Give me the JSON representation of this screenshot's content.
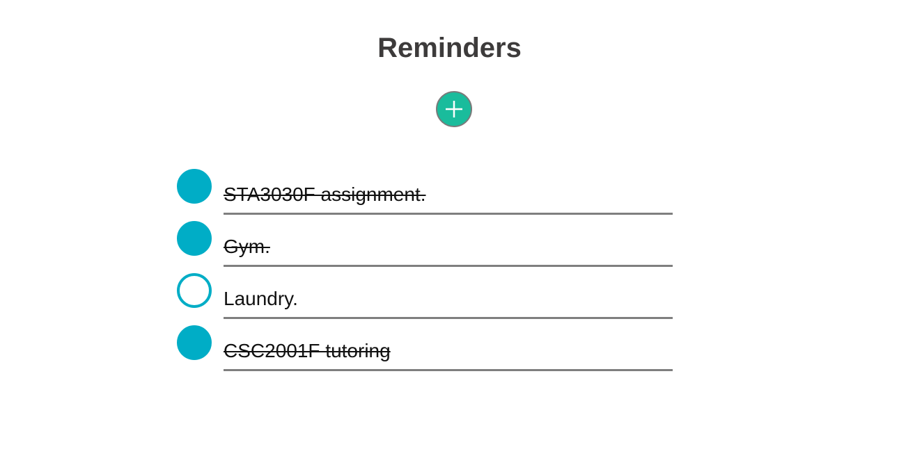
{
  "header": {
    "title": "Reminders"
  },
  "add_button": {
    "icon": "plus-icon",
    "color": "#1abc9c"
  },
  "reminders": [
    {
      "text": "STA3030F assignment.",
      "completed": true
    },
    {
      "text": "Gym.",
      "completed": true
    },
    {
      "text": "Laundry.",
      "completed": false
    },
    {
      "text": "CSC2001F tutoring",
      "completed": true
    }
  ],
  "colors": {
    "accent": "#00adc6",
    "title": "#3d3b3b",
    "divider": "#7f7f7f"
  }
}
